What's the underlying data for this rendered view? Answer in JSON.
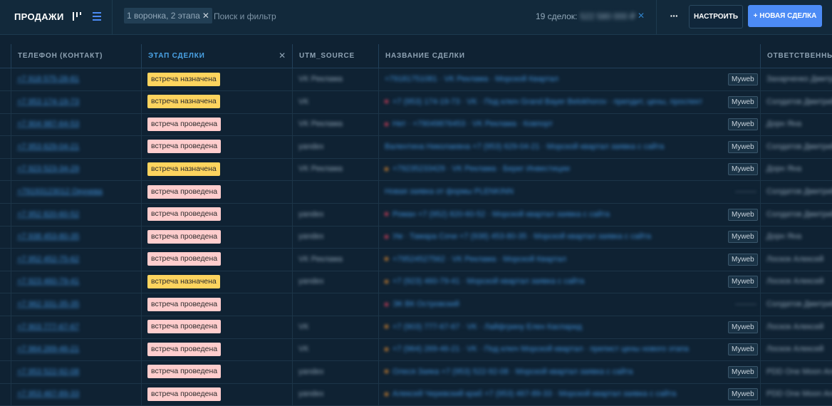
{
  "header": {
    "title": "ПРОДАЖИ",
    "filter_chip": "1 воронка, 2 этапа",
    "search_placeholder": "Поиск и фильтр",
    "deal_count": "19 сделок:",
    "deal_sum": "522 580 000 ₽",
    "more_label": "···",
    "settings_label": "НАСТРОИТЬ",
    "new_deal_label": "+ НОВАЯ СДЕЛКА"
  },
  "columns": {
    "phone": "ТЕЛЕФОН (КОНТАКТ)",
    "stage": "ЭТАП СДЕЛКИ",
    "utm": "UTM_SOURCE",
    "name": "НАЗВАНИЕ СДЕЛКИ",
    "responsible": "ОТВЕТСТВЕННЫЙ"
  },
  "colors": {
    "meeting_scheduled": "#fdd45e",
    "meeting_done": "#ffcdcd",
    "dot_orange": "#e08a2e",
    "dot_red": "#e0405b",
    "accent_blue": "#4c8bf5"
  },
  "rows": [
    {
      "phone": "+7 918 575-28-81",
      "stage": "встреча назначена",
      "stage_type": "scheduled",
      "utm": "VK Реклама",
      "dot": "",
      "name": "+79181751081 · VK Реклама · Морской Квартал",
      "source": "Myweb",
      "responsible": "Захарченко Дмитрий"
    },
    {
      "phone": "+7 953 174-19-73",
      "stage": "встреча назначена",
      "stage_type": "scheduled",
      "utm": "VK",
      "dot": "red",
      "name": "+7 (953) 174-19-73 · VK · Под ключ Grand Bayer Belokhorov · препдит, цены, проспект",
      "source": "Myweb",
      "responsible": "Солдатов Дмитрий"
    },
    {
      "phone": "+7 904 987-64-53",
      "stage": "встреча проведена",
      "stage_type": "done",
      "utm": "VK Реклама",
      "dot": "red",
      "name": "Нет · +79049876453 · VK Реклама · Ковпорт",
      "source": "Myweb",
      "responsible": "Дорн Яна"
    },
    {
      "phone": "+7 953 629-04-21",
      "stage": "встреча проведена",
      "stage_type": "done",
      "utm": "yandex",
      "dot": "",
      "name": "Валентина Николаевна +7 (953) 629-04-21 · Морской квартал заявка с сайта",
      "source": "Myweb",
      "responsible": "Солдатов Дмитрий"
    },
    {
      "phone": "+7 923 523-34-29",
      "stage": "встреча назначена",
      "stage_type": "scheduled",
      "utm": "VK Реклама",
      "dot": "orange",
      "name": "+79235233429 · VK Реклама · Берег Инвестиции",
      "source": "Myweb",
      "responsible": "Дорн Яна"
    },
    {
      "phone": "+79193123012 Окунева",
      "stage": "встреча проведена",
      "stage_type": "done",
      "utm": "",
      "dot": "",
      "name": "Новая заявка от формы PLENKINN",
      "source": "",
      "responsible": "Солдатов Дмитрий"
    },
    {
      "phone": "+7 952 820-60-52",
      "stage": "встреча проведена",
      "stage_type": "done",
      "utm": "yandex",
      "dot": "red",
      "name": "Роман +7 (952) 820-60-52 · Морской квартал заявка с сайта",
      "source": "Myweb",
      "responsible": "Солдатов Дмитрий"
    },
    {
      "phone": "+7 938 453-80-35",
      "stage": "встреча проведена",
      "stage_type": "done",
      "utm": "yandex",
      "dot": "red",
      "name": "Ум · Тамара Сочи +7 (938) 453-80-35 · Морской квартал заявка с сайта",
      "source": "Myweb",
      "responsible": "Дорн Яна"
    },
    {
      "phone": "+7 952 452-75-62",
      "stage": "встреча проведена",
      "stage_type": "done",
      "utm": "VK Реклама",
      "dot": "orange",
      "name": "+79524527562 · VK Реклама · Морской Квартал",
      "source": "Myweb",
      "responsible": "Лоскок Алексей"
    },
    {
      "phone": "+7 923 460-79-41",
      "stage": "встреча назначена",
      "stage_type": "scheduled",
      "utm": "yandex",
      "dot": "orange",
      "name": "+7 (923) 460-79-41 · Морской квартал заявка с сайта",
      "source": "Myweb",
      "responsible": "Лоскок Алексей"
    },
    {
      "phone": "+7 962 331-35-35",
      "stage": "встреча проведена",
      "stage_type": "done",
      "utm": "",
      "dot": "red",
      "name": "ЭК ВК Островский",
      "source": "",
      "responsible": "Солдатов Дмитрий"
    },
    {
      "phone": "+7 903 777-67-67",
      "stage": "встреча проведена",
      "stage_type": "done",
      "utm": "VK",
      "dot": "orange",
      "name": "+7 (903) 777-67-67 · VK · Лайфгрину Елен Каспарид",
      "source": "Myweb",
      "responsible": "Лоскок Алексей"
    },
    {
      "phone": "+7 964 269-46-21",
      "stage": "встреча проведена",
      "stage_type": "done",
      "utm": "VK",
      "dot": "orange",
      "name": "+7 (964) 269-46-21 · VK · Под ключ Морской квартал · препист цены нового этапа",
      "source": "Myweb",
      "responsible": "Лоскок Алексей"
    },
    {
      "phone": "+7 953 522-92-08",
      "stage": "встреча проведена",
      "stage_type": "done",
      "utm": "yandex",
      "dot": "orange",
      "name": "Олеся Заяка +7 (953) 522-92-08 · Морской квартал заявка с сайта",
      "source": "Myweb",
      "responsible": "PDD One Moon Aren"
    },
    {
      "phone": "+7 953 467-89-33",
      "stage": "встреча проведена",
      "stage_type": "done",
      "utm": "yandex",
      "dot": "orange",
      "name": "Алексей Черевский краб +7 (953) 467-89-33 · Морской квартал заявка с сайта",
      "source": "Myweb",
      "responsible": "PDD One Moon Aren"
    }
  ]
}
